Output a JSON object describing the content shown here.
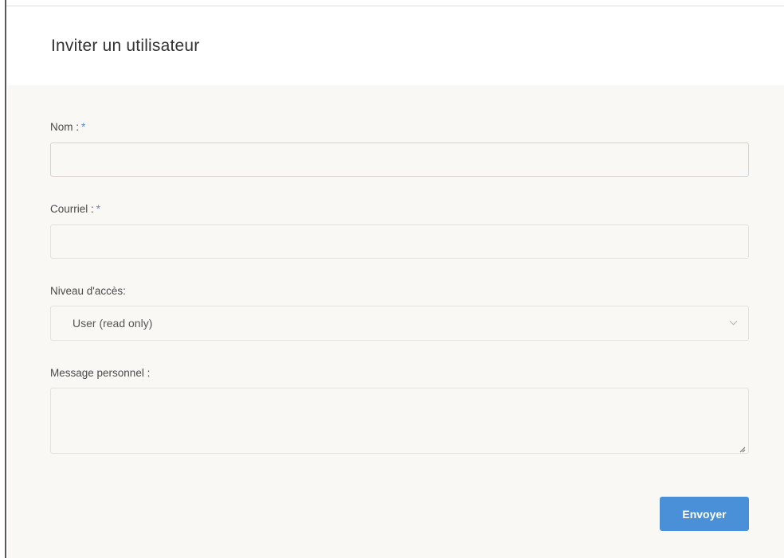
{
  "dialog": {
    "title": "Inviter un utilisateur"
  },
  "form": {
    "name": {
      "label": "Nom :",
      "required_marker": "*",
      "value": "",
      "placeholder": ""
    },
    "email": {
      "label": "Courriel :",
      "required_marker": "*",
      "value": "",
      "placeholder": ""
    },
    "access_level": {
      "label": "Niveau d'accès:",
      "selected": "User (read only)"
    },
    "message": {
      "label": "Message personnel :",
      "value": ""
    },
    "submit_label": "Envoyer"
  },
  "colors": {
    "accent": "#4a90d9",
    "body_background": "#f9f8f5",
    "title_text": "#333333"
  },
  "icons": {
    "select_chevron": "chevron-down-icon",
    "textarea_resize": "resize-grip-icon"
  }
}
